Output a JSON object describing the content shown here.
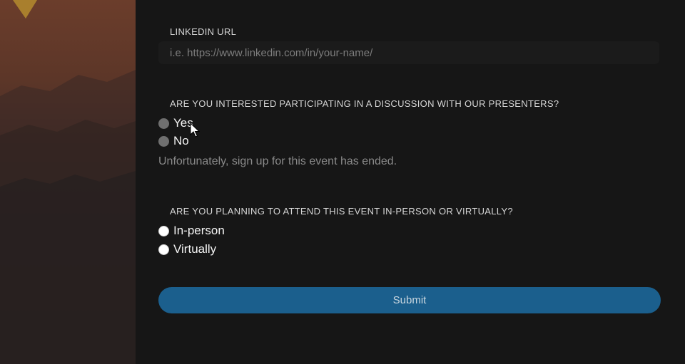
{
  "linkedin": {
    "label": "LINKEDIN URL",
    "placeholder": "i.e. https://www.linkedin.com/in/your-name/"
  },
  "discussion": {
    "label": "ARE YOU INTERESTED PARTICIPATING IN A DISCUSSION WITH OUR PRESENTERS?",
    "options": [
      {
        "label": "Yes",
        "disabled": true
      },
      {
        "label": "No",
        "disabled": true
      }
    ],
    "note": "Unfortunately, sign up for this event has ended."
  },
  "attendance": {
    "label": "ARE YOU PLANNING TO ATTEND THIS EVENT IN-PERSON OR VIRTUALLY?",
    "options": [
      {
        "label": "In-person"
      },
      {
        "label": "Virtually"
      }
    ]
  },
  "submit": {
    "label": "Submit"
  },
  "colors": {
    "button": "#1b5f8d",
    "background": "#161616",
    "disabled_radio": "#6f6f6f"
  }
}
